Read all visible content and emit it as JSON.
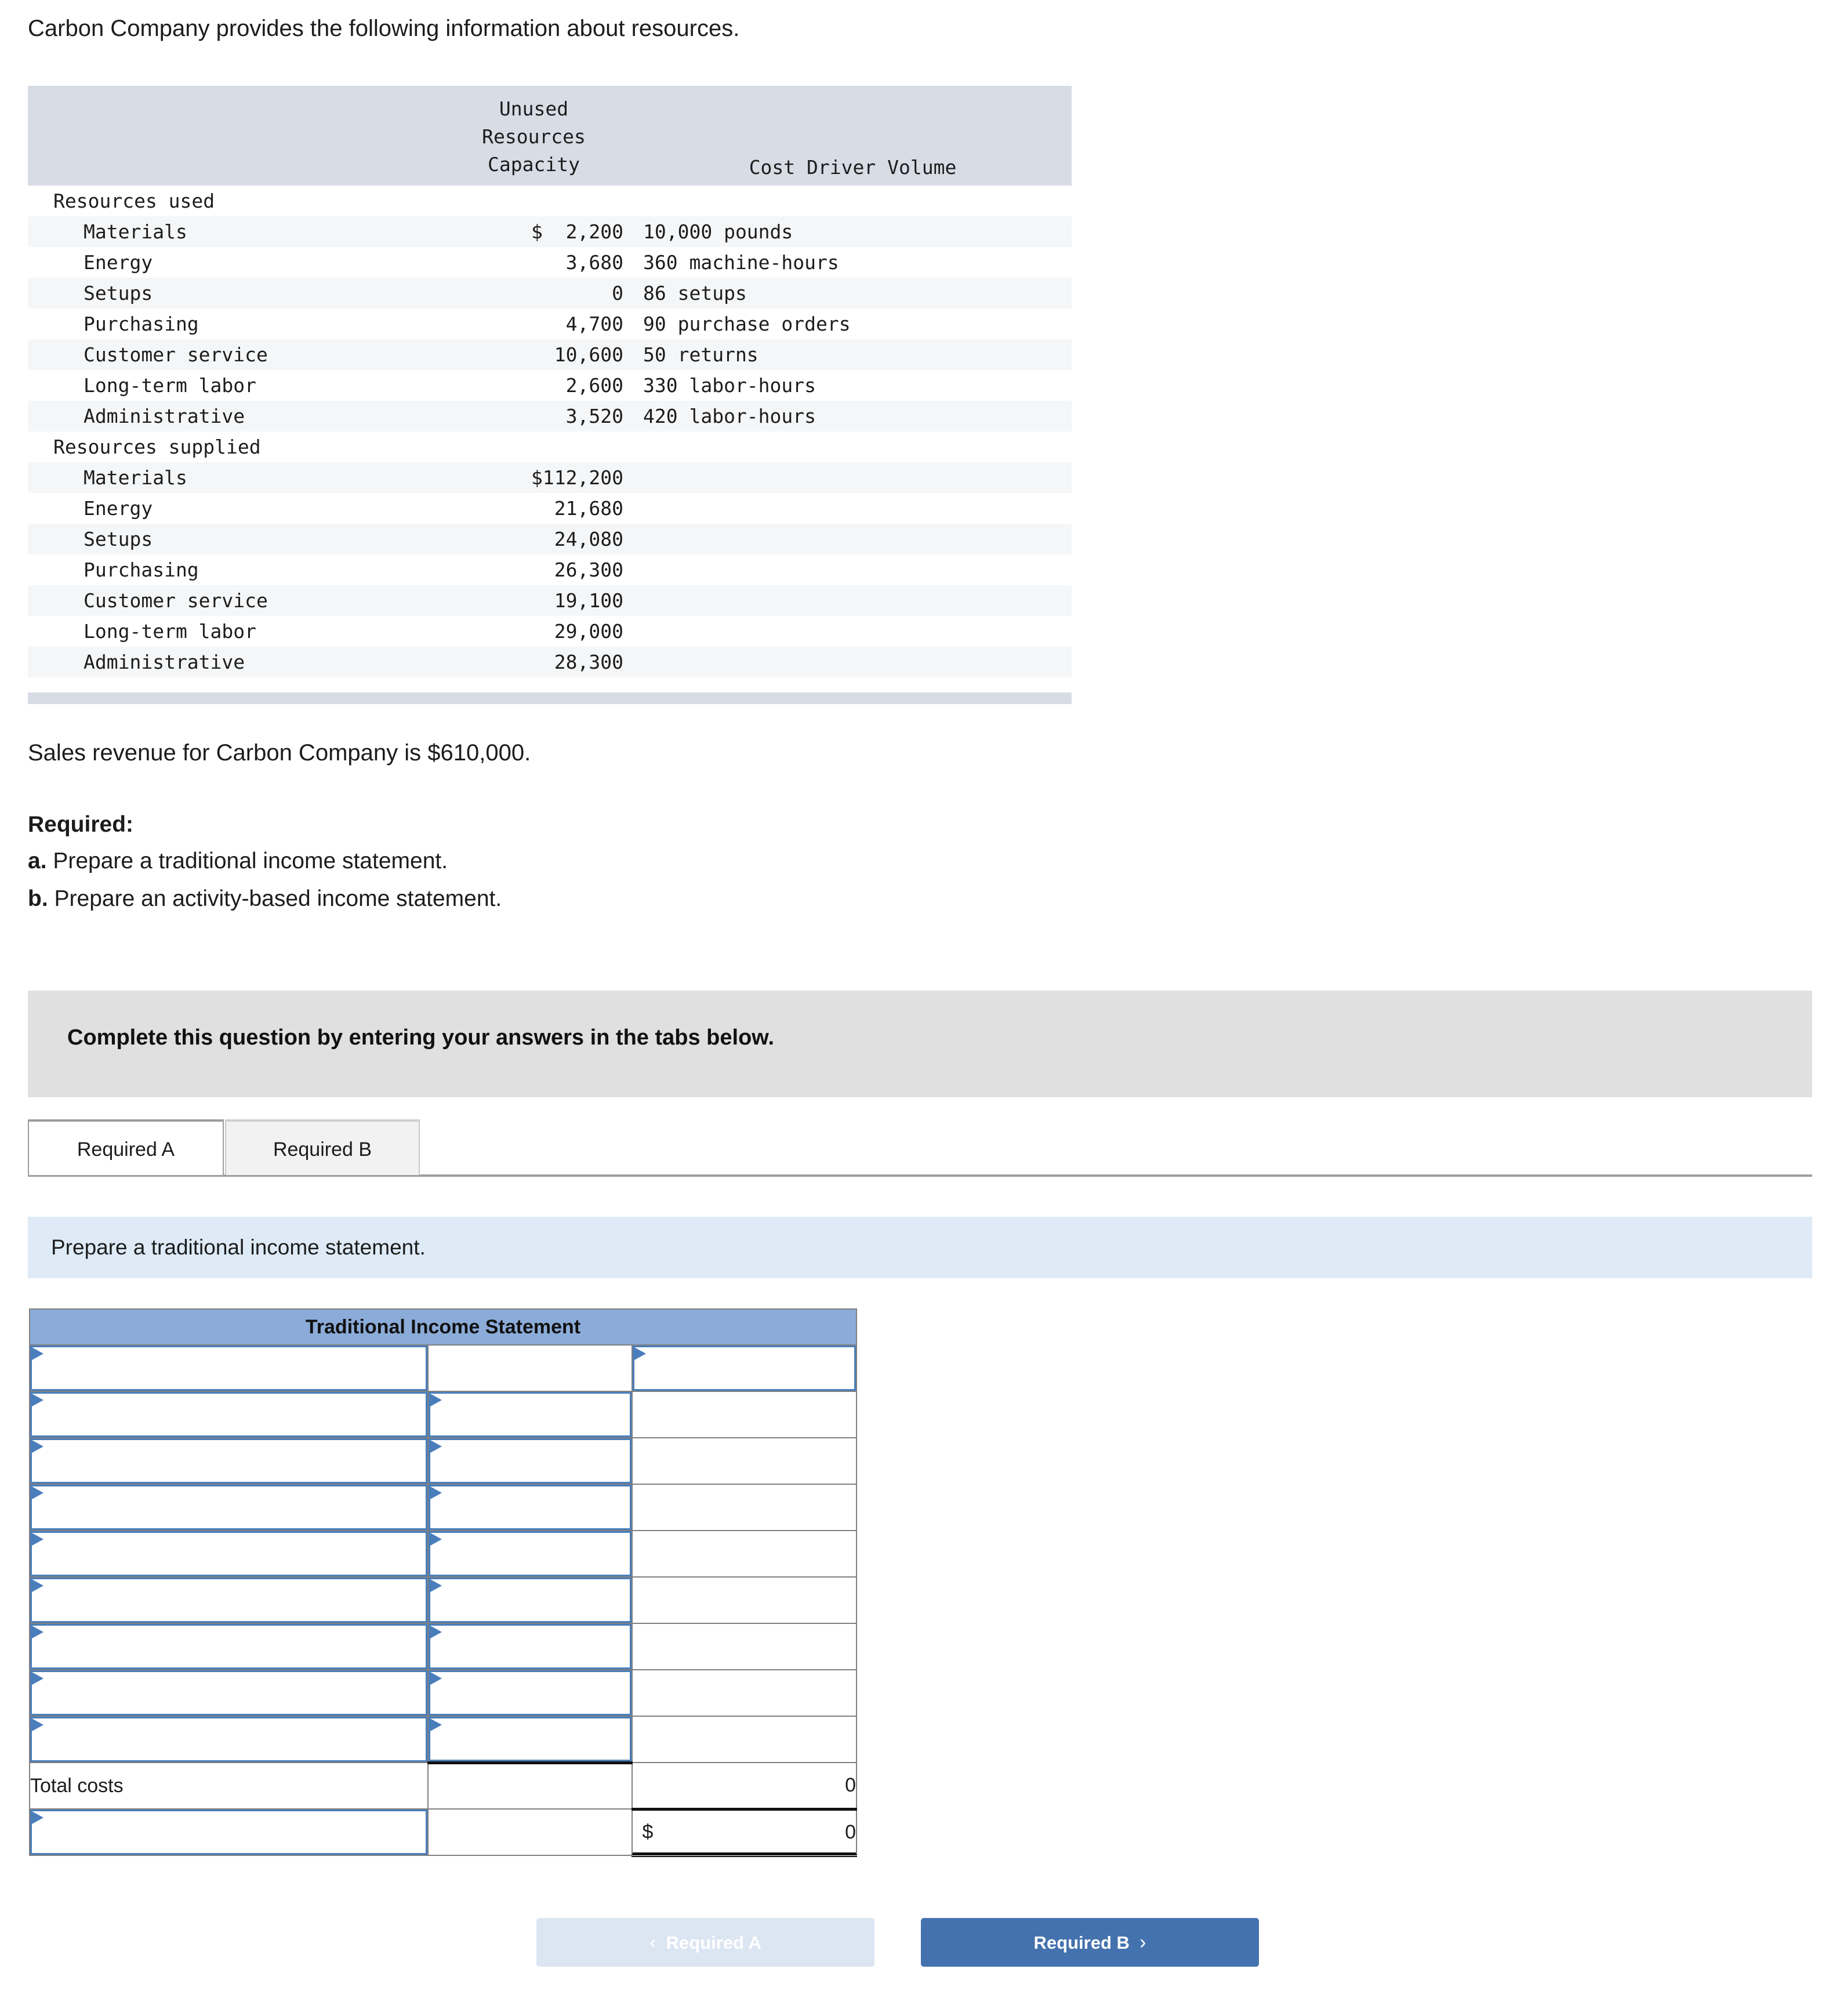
{
  "intro": {
    "text": "Carbon Company provides the following information about resources."
  },
  "resource_table": {
    "headers": [
      "",
      "Unused\nResources\nCapacity",
      "Cost Driver Volume"
    ],
    "header_col2_lines": [
      "Unused",
      "Resources",
      "Capacity"
    ],
    "header_col3": "Cost Driver Volume",
    "sections": [
      {
        "title": "Resources used",
        "rows": [
          {
            "label": "Materials",
            "currency": "$",
            "amount": "2,200",
            "driver": "10,000 pounds"
          },
          {
            "label": "Energy",
            "currency": "",
            "amount": "3,680",
            "driver": "360 machine-hours"
          },
          {
            "label": "Setups",
            "currency": "",
            "amount": "0",
            "driver": "86 setups"
          },
          {
            "label": "Purchasing",
            "currency": "",
            "amount": "4,700",
            "driver": "90 purchase orders"
          },
          {
            "label": "Customer service",
            "currency": "",
            "amount": "10,600",
            "driver": "50 returns"
          },
          {
            "label": "Long-term labor",
            "currency": "",
            "amount": "2,600",
            "driver": "330 labor-hours"
          },
          {
            "label": "Administrative",
            "currency": "",
            "amount": "3,520",
            "driver": "420 labor-hours"
          }
        ]
      },
      {
        "title": "Resources supplied",
        "rows": [
          {
            "label": "Materials",
            "currency": "$",
            "amount": "112,200",
            "driver": ""
          },
          {
            "label": "Energy",
            "currency": "",
            "amount": "21,680",
            "driver": ""
          },
          {
            "label": "Setups",
            "currency": "",
            "amount": "24,080",
            "driver": ""
          },
          {
            "label": "Purchasing",
            "currency": "",
            "amount": "26,300",
            "driver": ""
          },
          {
            "label": "Customer service",
            "currency": "",
            "amount": "19,100",
            "driver": ""
          },
          {
            "label": "Long-term labor",
            "currency": "",
            "amount": "29,000",
            "driver": ""
          },
          {
            "label": "Administrative",
            "currency": "",
            "amount": "28,300",
            "driver": ""
          }
        ]
      }
    ]
  },
  "sales_line": "Sales revenue for Carbon Company is $610,000.",
  "required": {
    "heading": "Required:",
    "item_a_marker": "a.",
    "item_a_text": " Prepare a traditional income statement.",
    "item_b_marker": "b.",
    "item_b_text": " Prepare an activity-based income statement."
  },
  "grey_banner": {
    "text": "Complete this question by entering your answers in the tabs below."
  },
  "tabs": [
    {
      "label": "Required A",
      "active": true
    },
    {
      "label": "Required B",
      "active": false
    }
  ],
  "blue_banner": {
    "text": "Prepare a traditional income statement."
  },
  "income_statement": {
    "title": "Traditional Income Statement",
    "rows": [
      {
        "kind": "sel-c3",
        "a": "",
        "b": "",
        "c": ""
      },
      {
        "kind": "sel-ab",
        "a": "",
        "b": "",
        "c": ""
      },
      {
        "kind": "sel-ab",
        "a": "",
        "b": "",
        "c": ""
      },
      {
        "kind": "sel-ab",
        "a": "",
        "b": "",
        "c": ""
      },
      {
        "kind": "sel-ab",
        "a": "",
        "b": "",
        "c": ""
      },
      {
        "kind": "sel-ab",
        "a": "",
        "b": "",
        "c": ""
      },
      {
        "kind": "sel-ab",
        "a": "",
        "b": "",
        "c": ""
      },
      {
        "kind": "sel-ab",
        "a": "",
        "b": "",
        "c": ""
      },
      {
        "kind": "sel-ab",
        "a": "",
        "b": "",
        "c": ""
      },
      {
        "kind": "total",
        "a": "Total costs",
        "b": "",
        "c": "0"
      },
      {
        "kind": "final",
        "a": "",
        "b": "",
        "c": "0",
        "c_currency": "$"
      }
    ],
    "total_label": "Total costs",
    "total_value": "0",
    "final_currency": "$",
    "final_value": "0"
  },
  "footer_nav": {
    "prev_label": "Required A",
    "prev_chevron": "‹",
    "next_label": "Required B",
    "next_chevron": "›"
  },
  "colors": {
    "table_header_bg": "#d7dce5",
    "row_alt_bg": "#f5f6f7",
    "grey_banner_bg": "#e0e0e0",
    "blue_banner_bg": "#deebf7",
    "is_title_bg": "#8bacd9",
    "select_border": "#4a7ebb",
    "next_button_bg": "#4472ae",
    "prev_button_bg": "#dce6f2"
  }
}
